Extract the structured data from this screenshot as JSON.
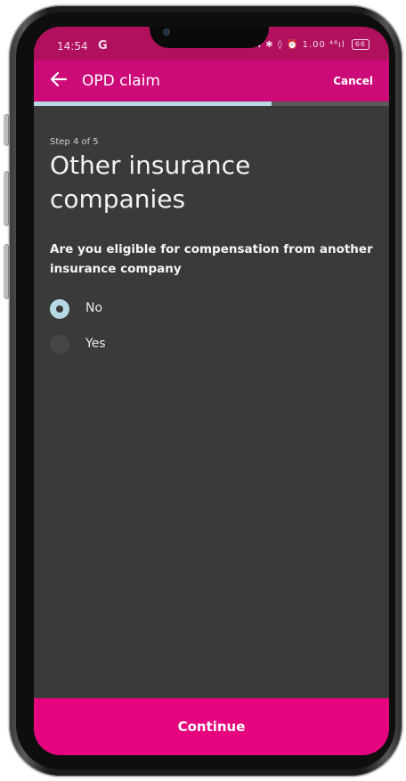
{
  "status_bar": {
    "time": "14:54",
    "g_icon": "G",
    "icons_text": "N ✱ ◊ ⏰ 1.00 ⁴⁶ıl",
    "battery": "66"
  },
  "app_bar": {
    "back_icon": "arrow-left-icon",
    "title": "OPD claim",
    "cancel_label": "Cancel"
  },
  "progress": {
    "current_step": 4,
    "total_steps": 5,
    "fraction": 0.67,
    "track_color": "#5a5a5a",
    "fill_color": "#b6d9e4"
  },
  "content": {
    "step_label": "Step 4 of 5",
    "title": "Other insurance companies",
    "question": "Are you eligible for compensation from another insurance company",
    "options": [
      {
        "label": "No",
        "selected": true
      },
      {
        "label": "Yes",
        "selected": false
      }
    ]
  },
  "footer": {
    "continue_label": "Continue"
  },
  "colors": {
    "status_bar": "#b0105e",
    "app_bar": "#cc0a78",
    "continue": "#e6057f",
    "background": "#3a3a3a",
    "accent": "#b6d9e4"
  }
}
